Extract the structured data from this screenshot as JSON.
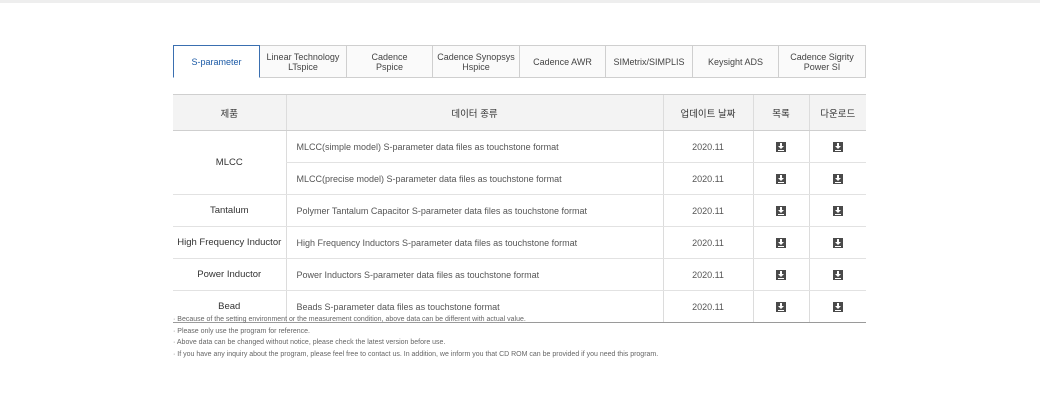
{
  "tabs": [
    {
      "label": "S-parameter",
      "active": true
    },
    {
      "label": "Linear Technology\nLTspice",
      "active": false
    },
    {
      "label": "Cadence\nPspice",
      "active": false
    },
    {
      "label": "Cadence Synopsys\nHspice",
      "active": false
    },
    {
      "label": "Cadence AWR",
      "active": false
    },
    {
      "label": "SIMetrix/SIMPLIS",
      "active": false
    },
    {
      "label": "Keysight ADS",
      "active": false
    },
    {
      "label": "Cadence Sigrity\nPower SI",
      "active": false
    }
  ],
  "table": {
    "headers": {
      "product": "제품",
      "data_type": "데이터 종류",
      "update_date": "업데이트 날짜",
      "list": "목록",
      "download": "다운로드"
    },
    "rows": [
      {
        "product": "MLCC",
        "rowspan": 2,
        "data_type": "MLCC(simple model) S-parameter data files as touchstone format",
        "date": "2020.11"
      },
      {
        "product": null,
        "data_type": "MLCC(precise model) S-parameter data files as touchstone format",
        "date": "2020.11"
      },
      {
        "product": "Tantalum",
        "rowspan": 1,
        "data_type": "Polymer Tantalum Capacitor S-parameter data files as touchstone format",
        "date": "2020.11"
      },
      {
        "product": "High Frequency Inductor",
        "rowspan": 1,
        "data_type": "High Frequency Inductors S-parameter data files as touchstone format",
        "date": "2020.11"
      },
      {
        "product": "Power Inductor",
        "rowspan": 1,
        "data_type": "Power Inductors S-parameter data files as touchstone format",
        "date": "2020.11"
      },
      {
        "product": "Bead",
        "rowspan": 1,
        "data_type": "Beads S-parameter data files as touchstone format",
        "date": "2020.11"
      }
    ],
    "icon": "download-icon"
  },
  "notes": [
    "· Because of the setting environment or the measurement condition, above data can be different with actual value.",
    "· Please only use the program for reference.",
    "· Above data can be changed without notice, please check the latest version before use.",
    "· If you have any inquiry about the program, please feel free to contact us. In addition, we inform you that CD ROM can be provided if you need this program."
  ],
  "colors": {
    "active_tab": "#1b5aa6",
    "header_bg": "#f3f3f3",
    "icon": "#4a4a4a"
  }
}
